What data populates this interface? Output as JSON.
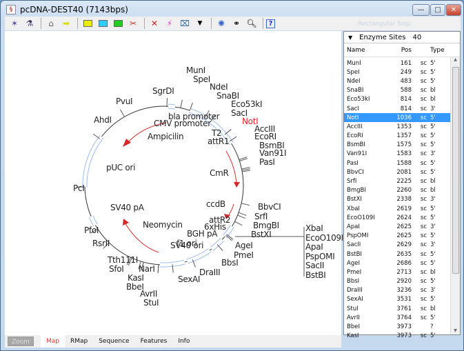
{
  "window": {
    "title": "pcDNA-DEST40 (7143bps)",
    "minimize": "—",
    "maximize": "□",
    "close": "✕"
  },
  "toolbar": {
    "icons": [
      "show-all-icon",
      "enzyme-icon",
      "home-icon",
      "forward-arrow-icon",
      "map-yellow-icon",
      "map-cyan-icon",
      "map-green-icon",
      "cut-icon",
      "delete-icon",
      "marker-icon",
      "frame-icon",
      "dropdown-icon",
      "enzyme-settings-icon",
      "binoculars-icon",
      "find-icon",
      "help-icon"
    ],
    "help_label": "?",
    "delete_label": "✕"
  },
  "map": {
    "enzymes": [
      "MunI",
      "SpeI",
      "NdeI",
      "SnaBI",
      "Eco53kI",
      "SacI",
      "NotI",
      "AccIII",
      "EcoRI",
      "BsmBI",
      "Van91I",
      "PasI",
      "BbvCI",
      "SrfI",
      "BmgBI",
      "BstXI",
      "AgeI",
      "PmeI",
      "BbsI",
      "DraIII",
      "SexAI",
      "StuI",
      "AvrII",
      "BbeI",
      "KasI",
      "NarI",
      "SfoI",
      "Tth111I",
      "RsrII",
      "PfoI",
      "PcI",
      "AhdI",
      "PvuI",
      "SgrDI"
    ],
    "cluster": [
      "XbaI",
      "EcoO109I",
      "ApaI",
      "PspOMI",
      "SacII",
      "BstBI"
    ],
    "features": [
      "bla promoter",
      "CMV promoter",
      "Ampicilin",
      "T2",
      "attR1",
      "pUC ori",
      "CmR",
      "ccdB",
      "SV40 pA",
      "Neomycin",
      "attR2",
      "6xHis",
      "BGH pA",
      "f1 ori",
      "SV40 ori"
    ],
    "highlight_color": "#e8222a",
    "feature_color": "#9bbcf0",
    "arrow_color": "#d42a2a"
  },
  "panel": {
    "faded_title": "Rectangular Snip",
    "header": "Enzyme Sites",
    "count": "40",
    "collapse": "▼",
    "columns": {
      "name": "Name",
      "pos": "Pos",
      "type": "Type"
    },
    "rows": [
      [
        "MunI",
        "161",
        "sc",
        "5'"
      ],
      [
        "SpeI",
        "249",
        "sc",
        "5'"
      ],
      [
        "NdeI",
        "483",
        "sc",
        "5'"
      ],
      [
        "SnaBI",
        "588",
        "sc",
        "bl"
      ],
      [
        "Eco53kI",
        "814",
        "sc",
        "bl"
      ],
      [
        "SacI",
        "814",
        "sc",
        "3'"
      ],
      [
        "NotI",
        "1036",
        "sc",
        "5'"
      ],
      [
        "AccIII",
        "1353",
        "sc",
        "5'"
      ],
      [
        "EcoRI",
        "1357",
        "sc",
        "5'"
      ],
      [
        "BsmBI",
        "1575",
        "sc",
        "5'"
      ],
      [
        "Van91I",
        "1583",
        "sc",
        "3'"
      ],
      [
        "PasI",
        "1588",
        "sc",
        "5'"
      ],
      [
        "BbvCI",
        "2081",
        "sc",
        "5'"
      ],
      [
        "SrfI",
        "2225",
        "sc",
        "bl"
      ],
      [
        "BmgBI",
        "2260",
        "sc",
        "bl"
      ],
      [
        "BstXI",
        "2338",
        "sc",
        "3'"
      ],
      [
        "XbaI",
        "2619",
        "sc",
        "5'"
      ],
      [
        "EcoO109I",
        "2624",
        "sc",
        "5'"
      ],
      [
        "ApaI",
        "2625",
        "sc",
        "3'"
      ],
      [
        "PspOMI",
        "2625",
        "sc",
        "5'"
      ],
      [
        "SacII",
        "2629",
        "sc",
        "3'"
      ],
      [
        "BstBI",
        "2635",
        "sc",
        "5'"
      ],
      [
        "AgeI",
        "2686",
        "sc",
        "5'"
      ],
      [
        "PmeI",
        "2713",
        "sc",
        "bl"
      ],
      [
        "BbsI",
        "2920",
        "sc",
        "5'"
      ],
      [
        "DraIII",
        "3236",
        "sc",
        "3'"
      ],
      [
        "SexAI",
        "3531",
        "sc",
        "5'"
      ],
      [
        "StuI",
        "3761",
        "sc",
        "bl"
      ],
      [
        "AvrII",
        "3764",
        "sc",
        "5'"
      ],
      [
        "BbeI",
        "3973",
        "",
        "?"
      ],
      [
        "KasI",
        "3973",
        "sc",
        "5'"
      ]
    ],
    "selected": "NotI"
  },
  "tabs": {
    "zoom": "Zoom",
    "items": [
      "Map",
      "RMap",
      "Sequence",
      "Features",
      "Info"
    ],
    "active": "Map"
  }
}
